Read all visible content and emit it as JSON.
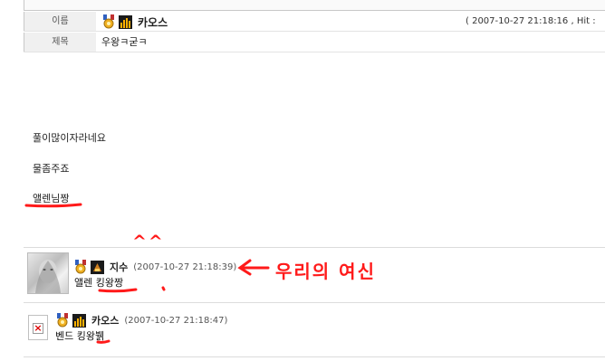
{
  "post": {
    "name_label": "이름",
    "subject_label": "제목",
    "author": "카오스",
    "meta": "( 2007-10-27 21:18:16 , Hit :",
    "subject": "우왕ㅋ굳ㅋ",
    "body_lines": [
      "풀이많이자라네요",
      "물좀주죠",
      "앨렌님짱"
    ]
  },
  "comments": [
    {
      "author": "지수",
      "date": "(2007-10-27 21:18:39)",
      "text": "앨렌 킹왕짱"
    },
    {
      "author": "카오스",
      "date": "(2007-10-27 21:18:47)",
      "text": "벤드 킹왕뷁"
    }
  ],
  "annotations": {
    "smile": "^^",
    "handwritten_note": "우리의 여신",
    "color": "#ff1a1a"
  },
  "icons": {
    "medal": "medal-icon",
    "level": "level-icon",
    "broken": "broken-image-icon"
  }
}
